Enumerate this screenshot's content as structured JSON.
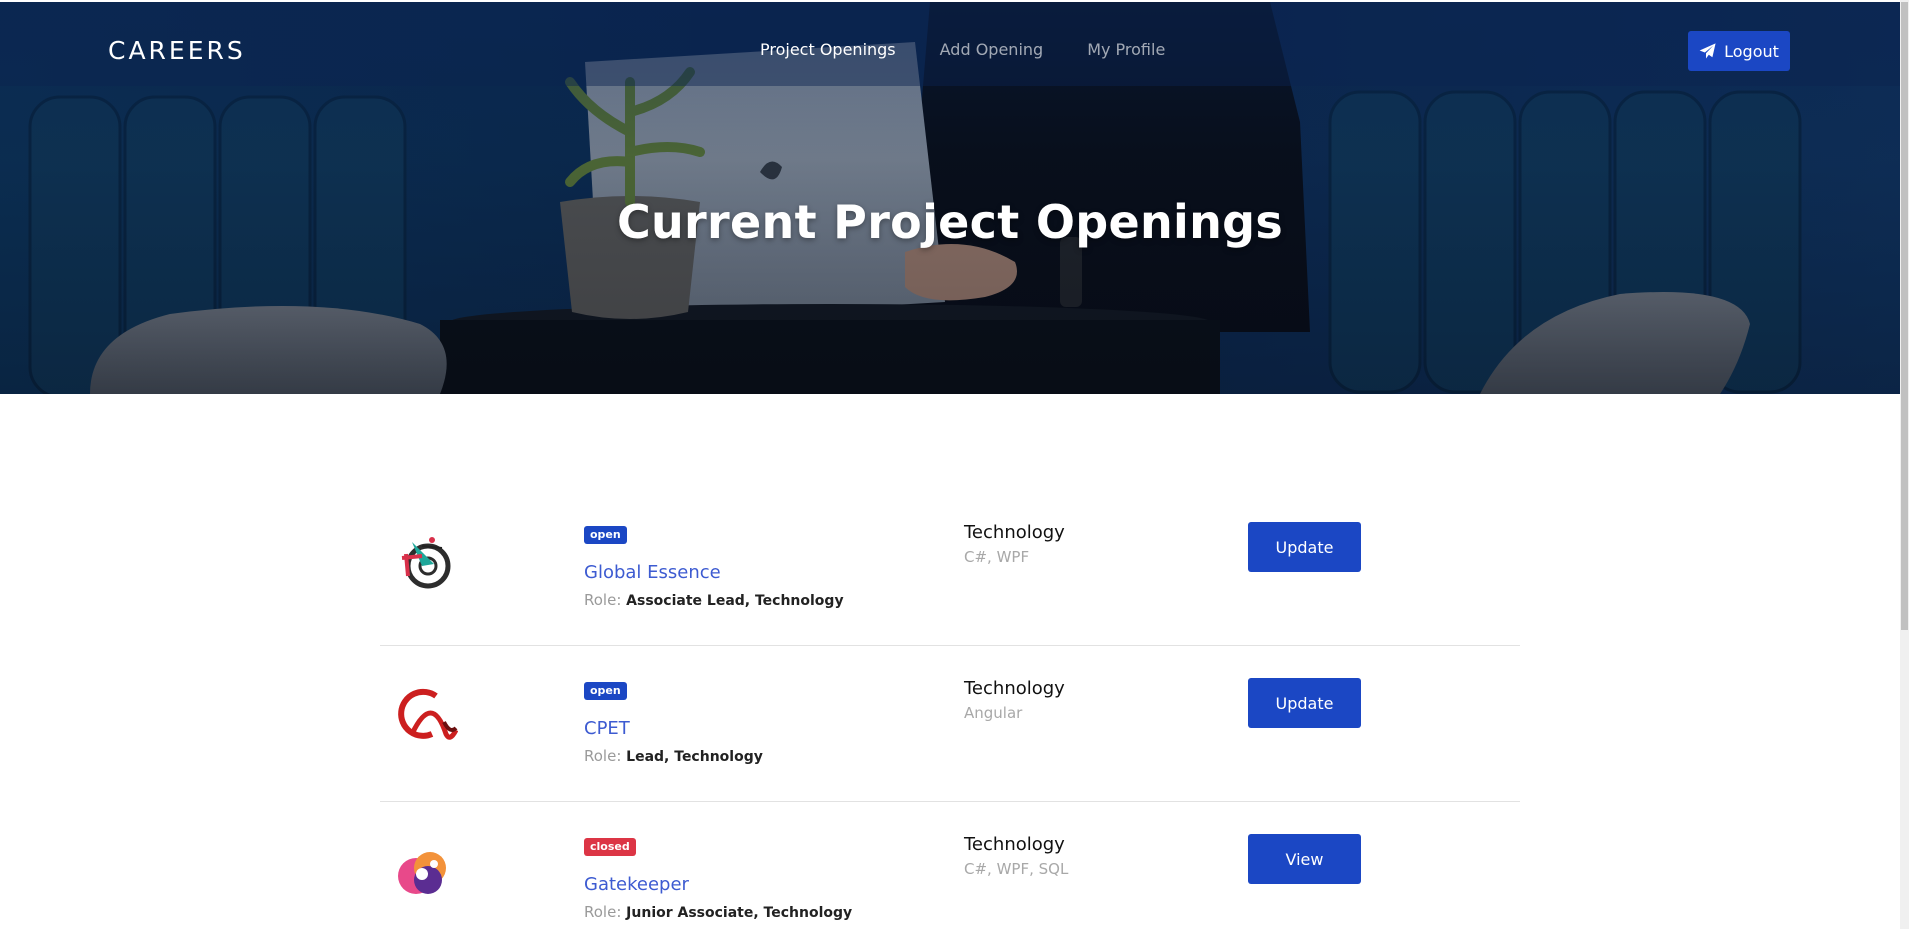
{
  "header": {
    "brand": "CAREERS",
    "nav": [
      {
        "label": "Project Openings",
        "active": true
      },
      {
        "label": "Add Opening",
        "active": false
      },
      {
        "label": "My Profile",
        "active": false
      }
    ],
    "logout_label": "Logout",
    "logout_icon": "paper-plane-icon"
  },
  "hero": {
    "title": "Current Project Openings"
  },
  "projects": [
    {
      "logo_icon": "global-essence-logo",
      "status": "open",
      "name": "Global Essence",
      "role_label": "Role:",
      "role": "Associate Lead, Technology",
      "category": "Technology",
      "skills": "C#, WPF",
      "action": "Update"
    },
    {
      "logo_icon": "cpet-logo",
      "status": "open",
      "name": "CPET",
      "role_label": "Role:",
      "role": "Lead, Technology",
      "category": "Technology",
      "skills": "Angular",
      "action": "Update"
    },
    {
      "logo_icon": "gatekeeper-logo",
      "status": "closed",
      "name": "Gatekeeper",
      "role_label": "Role:",
      "role": "Junior Associate, Technology",
      "category": "Technology",
      "skills": "C#, WPF, SQL",
      "action": "View"
    }
  ],
  "colors": {
    "primary": "#1b47c4",
    "link": "#3d5bd1",
    "danger": "#dc3545",
    "muted": "#9a9a9a"
  }
}
